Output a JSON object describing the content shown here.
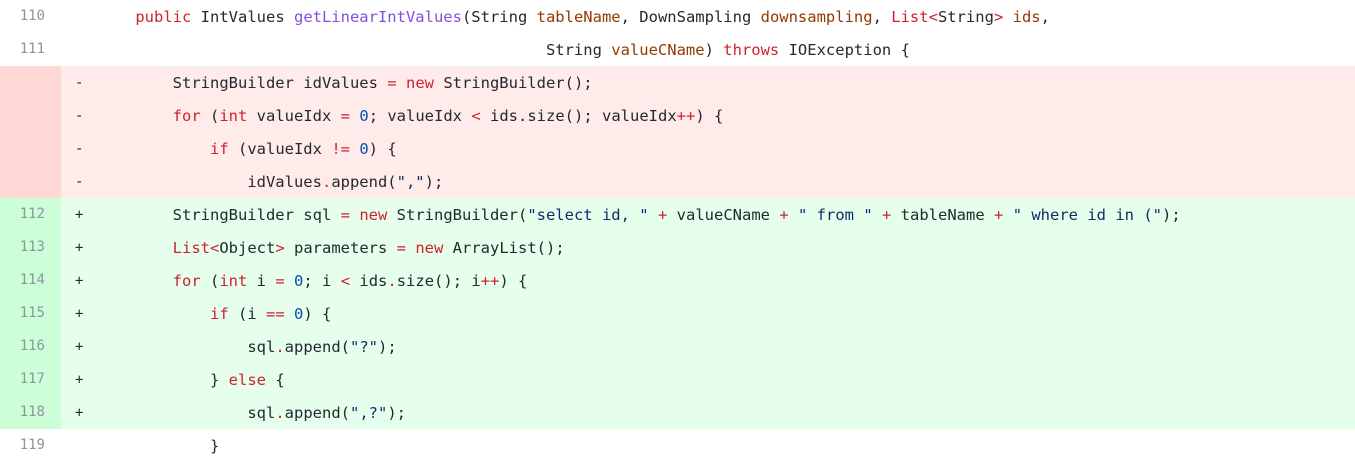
{
  "diff": {
    "lines": [
      {
        "type": "ctx",
        "num": "110",
        "marker": "",
        "indent": "    ",
        "tokens": [
          {
            "c": "kw",
            "t": "public"
          },
          {
            "c": "pl",
            "t": " IntValues "
          },
          {
            "c": "fn",
            "t": "getLinearIntValues"
          },
          {
            "c": "pl",
            "t": "(String "
          },
          {
            "c": "pa",
            "t": "tableName"
          },
          {
            "c": "pl",
            "t": ", DownSampling "
          },
          {
            "c": "pa",
            "t": "downsampling"
          },
          {
            "c": "pl",
            "t": ", "
          },
          {
            "c": "kw",
            "t": "List"
          },
          {
            "c": "op",
            "t": "<"
          },
          {
            "c": "pl",
            "t": "String"
          },
          {
            "c": "op",
            "t": ">"
          },
          {
            "c": "pl",
            "t": " "
          },
          {
            "c": "pa",
            "t": "ids"
          },
          {
            "c": "pl",
            "t": ","
          }
        ]
      },
      {
        "type": "ctx",
        "num": "111",
        "marker": "",
        "indent": "                                                ",
        "tokens": [
          {
            "c": "pl",
            "t": "String "
          },
          {
            "c": "pa",
            "t": "valueCName"
          },
          {
            "c": "pl",
            "t": ") "
          },
          {
            "c": "kw",
            "t": "throws"
          },
          {
            "c": "pl",
            "t": " IOException {"
          }
        ]
      },
      {
        "type": "del",
        "num": "",
        "marker": "-",
        "indent": "        ",
        "tokens": [
          {
            "c": "pl",
            "t": "StringBuilder idValues "
          },
          {
            "c": "op",
            "t": "="
          },
          {
            "c": "pl",
            "t": " "
          },
          {
            "c": "kw",
            "t": "new"
          },
          {
            "c": "pl",
            "t": " StringBuilder();"
          }
        ]
      },
      {
        "type": "del",
        "num": "",
        "marker": "-",
        "indent": "        ",
        "tokens": [
          {
            "c": "kw",
            "t": "for"
          },
          {
            "c": "pl",
            "t": " ("
          },
          {
            "c": "kw",
            "t": "int"
          },
          {
            "c": "pl",
            "t": " valueIdx "
          },
          {
            "c": "op",
            "t": "="
          },
          {
            "c": "pl",
            "t": " "
          },
          {
            "c": "nu",
            "t": "0"
          },
          {
            "c": "pl",
            "t": "; valueIdx "
          },
          {
            "c": "op",
            "t": "<"
          },
          {
            "c": "pl",
            "t": " ids.size(); valueIdx"
          },
          {
            "c": "op",
            "t": "++"
          },
          {
            "c": "pl",
            "t": ") {"
          }
        ]
      },
      {
        "type": "del",
        "num": "",
        "marker": "-",
        "indent": "            ",
        "tokens": [
          {
            "c": "kw",
            "t": "if"
          },
          {
            "c": "pl",
            "t": " (valueIdx "
          },
          {
            "c": "op",
            "t": "!="
          },
          {
            "c": "pl",
            "t": " "
          },
          {
            "c": "nu",
            "t": "0"
          },
          {
            "c": "pl",
            "t": ") {"
          }
        ]
      },
      {
        "type": "del",
        "num": "",
        "marker": "-",
        "indent": "                ",
        "tokens": [
          {
            "c": "pl",
            "t": "idValues"
          },
          {
            "c": "op",
            "t": "."
          },
          {
            "c": "pl",
            "t": "append("
          },
          {
            "c": "st",
            "t": "\",\""
          },
          {
            "c": "pl",
            "t": ");"
          }
        ]
      },
      {
        "type": "add",
        "num": "112",
        "marker": "+",
        "indent": "        ",
        "tokens": [
          {
            "c": "pl",
            "t": "StringBuilder sql "
          },
          {
            "c": "op",
            "t": "="
          },
          {
            "c": "pl",
            "t": " "
          },
          {
            "c": "kw",
            "t": "new"
          },
          {
            "c": "pl",
            "t": " StringBuilder("
          },
          {
            "c": "st",
            "t": "\"select id, \""
          },
          {
            "c": "pl",
            "t": " "
          },
          {
            "c": "op",
            "t": "+"
          },
          {
            "c": "pl",
            "t": " valueCName "
          },
          {
            "c": "op",
            "t": "+"
          },
          {
            "c": "pl",
            "t": " "
          },
          {
            "c": "st",
            "t": "\" from \""
          },
          {
            "c": "pl",
            "t": " "
          },
          {
            "c": "op",
            "t": "+"
          },
          {
            "c": "pl",
            "t": " tableName "
          },
          {
            "c": "op",
            "t": "+"
          },
          {
            "c": "pl",
            "t": " "
          },
          {
            "c": "st",
            "t": "\" where id in (\""
          },
          {
            "c": "pl",
            "t": ");"
          }
        ]
      },
      {
        "type": "add",
        "num": "113",
        "marker": "+",
        "indent": "        ",
        "tokens": [
          {
            "c": "kw",
            "t": "List"
          },
          {
            "c": "op",
            "t": "<"
          },
          {
            "c": "pl",
            "t": "Object"
          },
          {
            "c": "op",
            "t": ">"
          },
          {
            "c": "pl",
            "t": " parameters "
          },
          {
            "c": "op",
            "t": "="
          },
          {
            "c": "pl",
            "t": " "
          },
          {
            "c": "kw",
            "t": "new"
          },
          {
            "c": "pl",
            "t": " ArrayList();"
          }
        ]
      },
      {
        "type": "add",
        "num": "114",
        "marker": "+",
        "indent": "        ",
        "tokens": [
          {
            "c": "kw",
            "t": "for"
          },
          {
            "c": "pl",
            "t": " ("
          },
          {
            "c": "kw",
            "t": "int"
          },
          {
            "c": "pl",
            "t": " i "
          },
          {
            "c": "op",
            "t": "="
          },
          {
            "c": "pl",
            "t": " "
          },
          {
            "c": "nu",
            "t": "0"
          },
          {
            "c": "pl",
            "t": "; i "
          },
          {
            "c": "op",
            "t": "<"
          },
          {
            "c": "pl",
            "t": " ids"
          },
          {
            "c": "op",
            "t": "."
          },
          {
            "c": "pl",
            "t": "size(); i"
          },
          {
            "c": "op",
            "t": "++"
          },
          {
            "c": "pl",
            "t": ") {"
          }
        ]
      },
      {
        "type": "add",
        "num": "115",
        "marker": "+",
        "indent": "            ",
        "tokens": [
          {
            "c": "kw",
            "t": "if"
          },
          {
            "c": "pl",
            "t": " (i "
          },
          {
            "c": "op",
            "t": "=="
          },
          {
            "c": "pl",
            "t": " "
          },
          {
            "c": "nu",
            "t": "0"
          },
          {
            "c": "pl",
            "t": ") {"
          }
        ]
      },
      {
        "type": "add",
        "num": "116",
        "marker": "+",
        "indent": "                ",
        "tokens": [
          {
            "c": "pl",
            "t": "sql"
          },
          {
            "c": "op",
            "t": "."
          },
          {
            "c": "pl",
            "t": "append("
          },
          {
            "c": "st",
            "t": "\"?\""
          },
          {
            "c": "pl",
            "t": ");"
          }
        ]
      },
      {
        "type": "add",
        "num": "117",
        "marker": "+",
        "indent": "            ",
        "tokens": [
          {
            "c": "pl",
            "t": "} "
          },
          {
            "c": "kw",
            "t": "else"
          },
          {
            "c": "pl",
            "t": " {"
          }
        ]
      },
      {
        "type": "add",
        "num": "118",
        "marker": "+",
        "indent": "                ",
        "tokens": [
          {
            "c": "pl",
            "t": "sql"
          },
          {
            "c": "op",
            "t": "."
          },
          {
            "c": "pl",
            "t": "append("
          },
          {
            "c": "st",
            "t": "\",?\""
          },
          {
            "c": "pl",
            "t": ");"
          }
        ]
      },
      {
        "type": "ctx",
        "num": "119",
        "marker": "",
        "indent": "            ",
        "tokens": [
          {
            "c": "pl",
            "t": "}"
          }
        ]
      }
    ]
  },
  "colors": {
    "deleted_bg": "#ffebe9",
    "deleted_gutter": "#ffd7d5",
    "added_bg": "#e6ffec",
    "added_gutter": "#ccffd8",
    "keyword": "#cf222e",
    "function": "#8250df",
    "param": "#953800",
    "string": "#0a3069",
    "number": "#0550ae"
  }
}
